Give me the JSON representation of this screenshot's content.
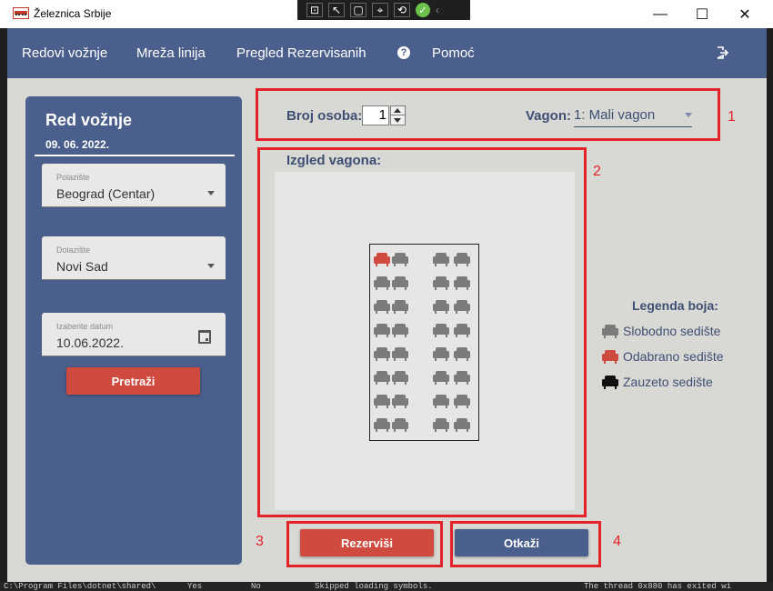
{
  "window": {
    "title": "Železnica Srbije",
    "controls": {
      "minimize": "—",
      "maximize": "☐",
      "close": "✕"
    }
  },
  "debug_toolbar": {
    "icons": [
      "select-element-icon",
      "pointer-icon",
      "layout-icon",
      "track-focus-icon",
      "hot-reload-icon",
      "check-icon",
      "collapse-icon"
    ]
  },
  "navbar": {
    "items": [
      "Redovi vožnje",
      "Mreža linija",
      "Pregled Rezervisanih",
      "Pomoć"
    ],
    "help_glyph": "?"
  },
  "sidebar": {
    "title": "Red vožnje",
    "date": "09. 06. 2022.",
    "departure": {
      "label": "Polazište",
      "value": "Beograd (Centar)"
    },
    "arrival": {
      "label": "Dolazište",
      "value": "Novi Sad"
    },
    "date_field": {
      "label": "Izaberite datum",
      "value": "10.06.2022."
    },
    "search_button": "Pretraži"
  },
  "booking": {
    "persons_label": "Broj osoba:",
    "persons_value": "1",
    "wagon_label": "Vagon:",
    "wagon_value": "1: Mali vagon",
    "layout_label": "Izgled vagona:",
    "reserve_button": "Rezerviši",
    "cancel_button": "Otkaži"
  },
  "seat_map": {
    "rows": 8,
    "seats_per_row": 4,
    "selected": [
      [
        0,
        0
      ]
    ],
    "occupied": []
  },
  "legend": {
    "title": "Legenda boja:",
    "items": [
      {
        "label": "Slobodno sedište",
        "color": "#7b7b7b"
      },
      {
        "label": "Odabrano sedište",
        "color": "#cf4a3f"
      },
      {
        "label": "Zauzeto sedište",
        "color": "#111111"
      }
    ]
  },
  "annotations": {
    "n1": "1",
    "n2": "2",
    "n3": "3",
    "n4": "4"
  },
  "colors": {
    "primary": "#4b5f8c",
    "accent_red": "#cf4a3f",
    "annotation_red": "#e3222a",
    "background": "#d8d8d4"
  },
  "background_console": {
    "path": "C:\\Program Files\\dotnet\\shared\\",
    "col2": "Yes",
    "col3": "No",
    "col4": "Skipped loading symbols.",
    "right": "The thread 0x880 has exited wi"
  }
}
